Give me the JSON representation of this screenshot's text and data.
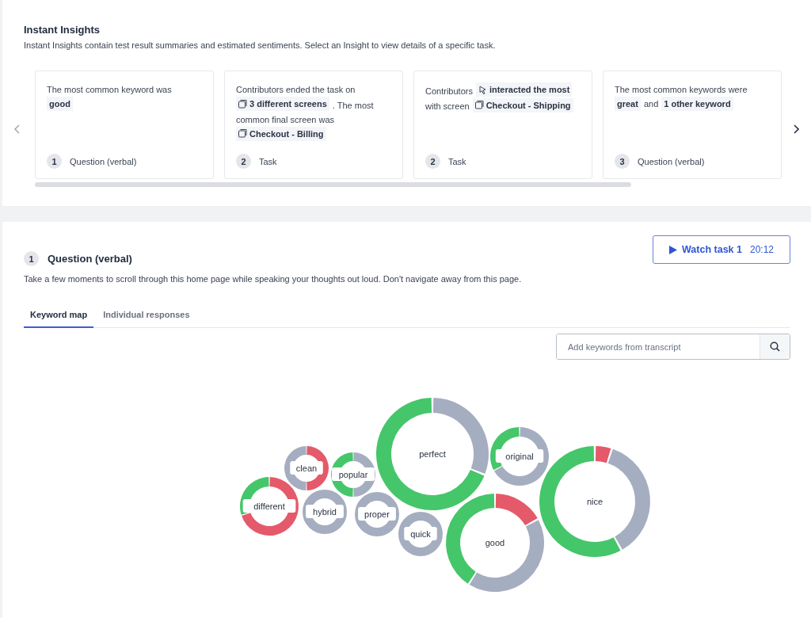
{
  "insights": {
    "title": "Instant Insights",
    "description": "Instant Insights contain test result summaries and estimated sentiments. Select an Insight to view details of a specific task.",
    "cards": [
      {
        "segments": [
          {
            "kind": "text",
            "text": "The most common keyword was"
          },
          {
            "kind": "keyword",
            "text": "good"
          }
        ],
        "badge": "1",
        "task": "Question (verbal)"
      },
      {
        "segments": [
          {
            "kind": "text",
            "text": "Contributors ended the task on"
          },
          {
            "kind": "screen",
            "text": "3 different screens"
          },
          {
            "kind": "text",
            "text": ". The most"
          },
          {
            "kind": "text",
            "text": "common final screen was"
          },
          {
            "kind": "screen",
            "text": "Checkout - Billing"
          }
        ],
        "badge": "2",
        "task": "Task"
      },
      {
        "segments": [
          {
            "kind": "text",
            "text": "Contributors"
          },
          {
            "kind": "interaction",
            "text": "interacted the most"
          },
          {
            "kind": "text",
            "text": "with screen"
          },
          {
            "kind": "screen",
            "text": "Checkout - Shipping"
          }
        ],
        "badge": "2",
        "task": "Task"
      },
      {
        "segments": [
          {
            "kind": "text",
            "text": "The most common keywords were"
          },
          {
            "kind": "keyword",
            "text": "great"
          },
          {
            "kind": "text",
            "text": "and"
          },
          {
            "kind": "keyword",
            "text": "1 other keyword"
          }
        ],
        "badge": "3",
        "task": "Question (verbal)"
      }
    ]
  },
  "question": {
    "badge": "1",
    "title": "Question (verbal)",
    "watch_button": {
      "label": "Watch task 1",
      "duration": "20:12"
    },
    "description": "Take a few moments to scroll through this home page while speaking your thoughts out loud. Don't navigate away from this page.",
    "tabs": [
      {
        "label": "Keyword map",
        "selected": true
      },
      {
        "label": "Individual responses",
        "selected": false
      }
    ],
    "search": {
      "placeholder": "Add keywords from transcript"
    },
    "keywords": [
      {
        "label": "different",
        "chart_data": {
          "type": "donut",
          "values": [
            0.7,
            0,
            0.3
          ]
        }
      },
      {
        "label": "clean",
        "chart_data": {
          "type": "donut",
          "values": [
            0.5,
            0.5,
            0
          ]
        }
      },
      {
        "label": "hybrid",
        "kind": "neutral"
      },
      {
        "label": "popular",
        "chart_data": {
          "type": "donut",
          "values": [
            0,
            0.5,
            0.5
          ]
        }
      },
      {
        "label": "proper",
        "kind": "neutral"
      },
      {
        "label": "quick",
        "kind": "neutral"
      },
      {
        "label": "perfect",
        "chart_data": {
          "type": "donut",
          "values": [
            0,
            0.31,
            0.69
          ]
        }
      },
      {
        "label": "original",
        "chart_data": {
          "type": "donut",
          "values": [
            0,
            0.67,
            0.33
          ]
        }
      },
      {
        "label": "good",
        "chart_data": {
          "type": "donut",
          "values": [
            0.17,
            0.42,
            0.41
          ]
        }
      },
      {
        "label": "nice",
        "chart_data": {
          "type": "donut",
          "values": [
            0.05,
            0.37,
            0.58
          ]
        }
      }
    ]
  }
}
